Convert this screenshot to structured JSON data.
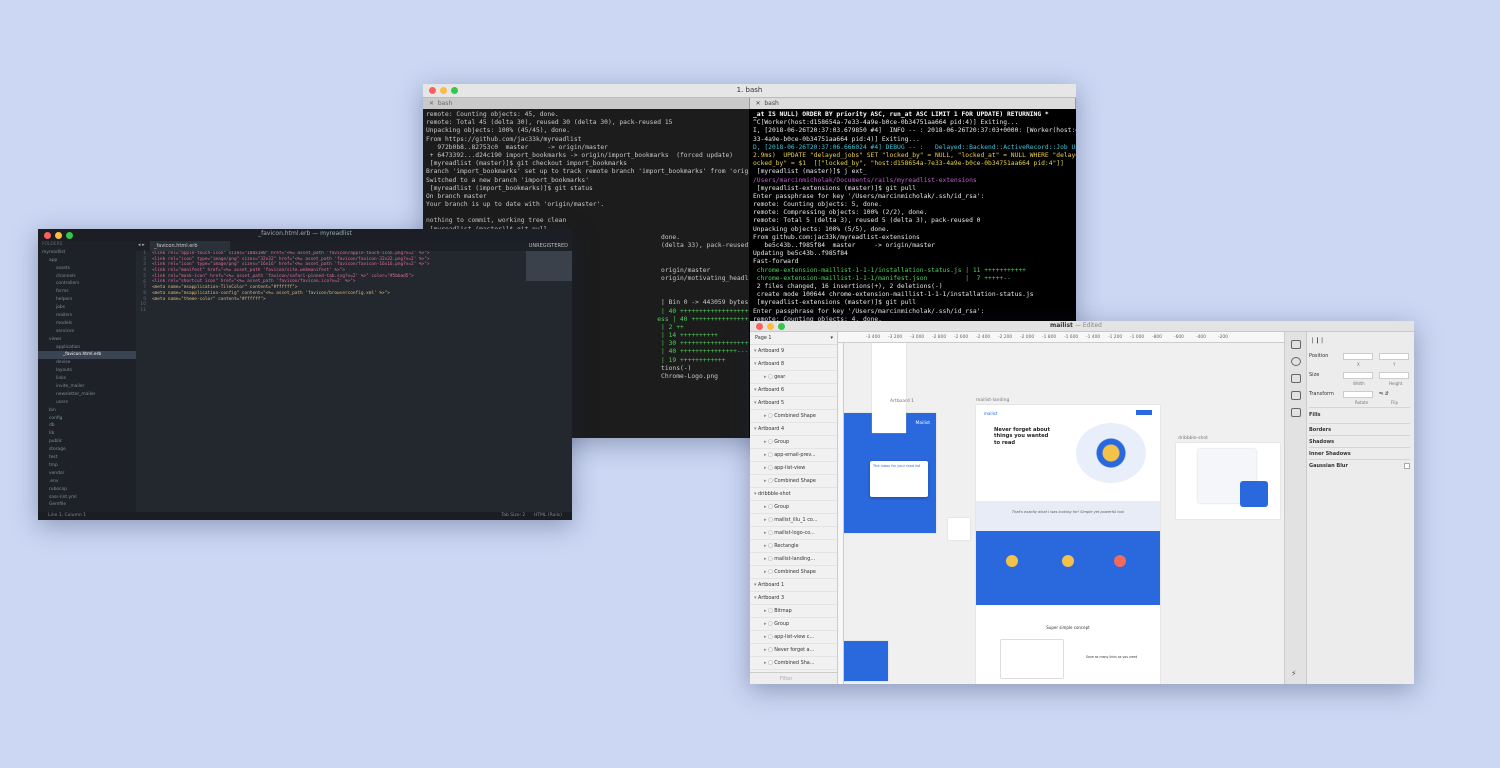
{
  "terminal": {
    "title": "1. bash",
    "left_tab": "bash",
    "right_tab": "bash",
    "left_lines": [
      "remote: Counting objects: 45, done.",
      "remote: Total 45 (delta 30), reused 30 (delta 30), pack-reused 15",
      "Unpacking objects: 100% (45/45), done.",
      "From https://github.com/jac33k/myreadlist",
      "   972b0b8..82753c0  master     -> origin/master",
      " + 6473392...d24c190 import_bookmarks -> origin/import_bookmarks  (forced update)",
      " [myreadlist (master)]$ git checkout import_bookmarks",
      "Branch 'import_bookmarks' set up to track remote branch 'import_bookmarks' from 'origin'.",
      "Switched to a new branch 'import_bookmarks'",
      " [myreadlist (import_bookmarks)]$ git status",
      "On branch master",
      "Your branch is up to date with 'origin/master'.",
      "",
      "nothing to commit, working tree clean",
      " [myreadlist (master)]$ git pull",
      "                                                              done.",
      "                                                              (delta 33), pack-reused 0",
      "",
      "",
      "                                                              origin/master",
      "                                                              origin/motivating_headline",
      "",
      "",
      "                                                              | Bin 0 -> 443059 bytes",
      "                                                              | 40 ++++++++++++++++++++++++++++++++++",
      "                                                             ess | 40 ++++++++++++++++++++++++++++++---",
      "                                                              | 2 ++",
      "                                                              | 14 ++++++++++",
      "                                                              | 30 +++++++++++++++++++-----",
      "                                                              | 40 +++++++++++++++---------",
      "                                                              | 19 ++++++++++++",
      "                                                              tions(-)",
      "                                                              Chrome-Logo.png"
    ],
    "right_lines": [
      "_at IS NULL) ORDER BY priority ASC, run_at ASC LIMIT 1 FOR UPDATE) RETURNING *",
      "^C[Worker(host:d158654a-7e33-4a9e-b0ce-0b34751aa664 pid:4)] Exiting...",
      "I, [2018-06-26T20:37:03.679850 #4]  INFO -- : 2018-06-26T20:37:03+0000: [Worker(host:d158654a-7e",
      "33-4a9e-b0ce-0b34751aa664 pid:4)] Exiting...",
      "D, [2018-06-26T20:37:06.666024 #4] DEBUG -- :   Delayed::Backend::ActiveRecord::Job Update All (",
      "2.9ms)  UPDATE \"delayed_jobs\" SET \"locked_by\" = NULL, \"locked_at\" = NULL WHERE \"delayed_jobs\".\"l",
      "ocked_by\" = $1  [[\"locked_by\", \"host:d158654a-7e33-4a9e-b0ce-0b34751aa664 pid:4\"]]",
      " [myreadlist (master)]$ j ext_",
      "/Users/marcinmicholak/Documents/rails/myreadlist-extensions",
      " [myreadlist-extensions (master)]$ git pull",
      "Enter passphrase for key '/Users/marcinmicholak/.ssh/id_rsa':",
      "remote: Counting objects: 5, done.",
      "remote: Compressing objects: 100% (2/2), done.",
      "remote: Total 5 (delta 3), reused 5 (delta 3), pack-reused 0",
      "Unpacking objects: 100% (5/5), done.",
      "From github.com:jac33k/myreadlist-extensions",
      "   be5c43b..f985f84  master     -> origin/master",
      "Updating be5c43b..f985f84",
      "Fast-forward",
      " chrome-extension-maillist-1-1-1/installation-status.js | 11 +++++++++++",
      " chrome-extension-maillist-1-1-1/manifest.json          |  7 +++++--",
      " 2 files changed, 16 insertions(+), 2 deletions(-)",
      " create mode 100644 chrome-extension-maillist-1-1-1/installation-status.js",
      " [myreadlist-extensions (master)]$ git pull",
      "Enter passphrase for key '/Users/marcinmicholak/.ssh/id_rsa':",
      "remote: Counting objects: 4, done."
    ]
  },
  "editor": {
    "title": "_favicon.html.erb — myreadlist",
    "tab": "_favicon.html.erb",
    "unregistered": "UNREGISTERED",
    "status_left": "Line 1, Column 1",
    "status_tab": "Tab Size: 2",
    "status_syntax": "HTML (Rails)",
    "folders_label": "FOLDERS",
    "tree": [
      "myreadlist",
      "app",
      "assets",
      "channels",
      "controllers",
      "forms",
      "helpers",
      "jobs",
      "mailers",
      "models",
      "services",
      "views",
      "application",
      "_favicon.html.erb",
      "devise",
      "layouts",
      "links",
      "invite_mailer",
      "newsletter_mailer",
      "users",
      "bin",
      "config",
      "db",
      "lib",
      "public",
      "storage",
      "test",
      "tmp",
      "vendor",
      ".env",
      "rubocop",
      "sass-lint.yml",
      "Gemfile"
    ],
    "code_lines": [
      "<link rel=\"apple-touch-icon\" sizes=\"180x180\" href=\"<%= asset_path 'favicon/apple-touch-icon.png?v=2' %>\">",
      "<link rel=\"icon\" type=\"image/png\" sizes=\"32x32\" href=\"<%= asset_path 'favicon/favicon-32x32.png?v=2' %>\">",
      "<link rel=\"icon\" type=\"image/png\" sizes=\"16x16\" href=\"<%= asset_path 'favicon/favicon-16x16.png?v=2' %>\">",
      "<link rel=\"manifest\" href=\"<%= asset_path 'favicon/site.webmanifest' %>\">",
      "<link rel=\"mask-icon\" href=\"<%= asset_path 'favicon/safari-pinned-tab.svg?v=2' %>\" color=\"#5bbad5\">",
      "<link rel=\"shortcut icon\" href=\"<%= asset_path 'favicon/favicon.ico?v=2' %>\">",
      "<meta name=\"msapplication-TileColor\" content=\"#ffffff\">",
      "<meta name=\"msapplication-config\" content=\"<%= asset_path 'favicon/browserconfig.xml' %>\">",
      "<meta name=\"theme-color\" content=\"#ffffff\">",
      "",
      ""
    ]
  },
  "sketch": {
    "title": "mailist",
    "title_suffix": "— Edited",
    "page": "Page 1",
    "layers": [
      {
        "label": "Artboard 9",
        "indent": 0
      },
      {
        "label": "Artboard 8",
        "indent": 0
      },
      {
        "label": "gear",
        "indent": 1
      },
      {
        "label": "Artboard 6",
        "indent": 0
      },
      {
        "label": "Artboard 5",
        "indent": 0
      },
      {
        "label": "Combined Shape",
        "indent": 1
      },
      {
        "label": "Artboard 4",
        "indent": 0
      },
      {
        "label": "Group",
        "indent": 1
      },
      {
        "label": "app-email-prev...",
        "indent": 1
      },
      {
        "label": "app-list-view",
        "indent": 1
      },
      {
        "label": "Combined Shape",
        "indent": 1
      },
      {
        "label": "dribbble-shot",
        "indent": 0
      },
      {
        "label": "Group",
        "indent": 1
      },
      {
        "label": "mailist_illu_1 co...",
        "indent": 1
      },
      {
        "label": "mailist-logo-co...",
        "indent": 1
      },
      {
        "label": "Rectangle",
        "indent": 1
      },
      {
        "label": "mailist-landing...",
        "indent": 1
      },
      {
        "label": "Combined Shape",
        "indent": 1
      },
      {
        "label": "Artboard 1",
        "indent": 0
      },
      {
        "label": "Artboard 3",
        "indent": 0
      },
      {
        "label": "Bitmap",
        "indent": 1
      },
      {
        "label": "Group",
        "indent": 1
      },
      {
        "label": "app-list-view c...",
        "indent": 1
      },
      {
        "label": "Never forget a...",
        "indent": 1
      },
      {
        "label": "Combined Sha...",
        "indent": 1
      }
    ],
    "filter_placeholder": "Filter",
    "ruler": [
      "-3 400",
      "-3 200",
      "-3 000",
      "-2 800",
      "-2 600",
      "-2 400",
      "-2 200",
      "-2 000",
      "-1 800",
      "-1 600",
      "-1 400",
      "-1 200",
      "-1 000",
      "-800",
      "-600",
      "-400",
      "-200"
    ],
    "inspector": {
      "position": "Position",
      "x": "X",
      "y": "Y",
      "size": "Size",
      "width": "Width",
      "height": "Height",
      "transform": "Transform",
      "rotate": "Rotate",
      "flip": "Flip",
      "fills": "Fills",
      "borders": "Borders",
      "shadows": "Shadows",
      "inner_shadows": "Inner Shadows",
      "gaussian_blur": "Gaussian Blur"
    },
    "artboards": {
      "a1": "Artboard 1",
      "landing": "mailist-landing",
      "dribbble": "dribbble-shot"
    },
    "landing": {
      "logo": "mailist",
      "headline": "Never forget about things you wanted to read",
      "tagline": "That's exactly what I was looking for! Simple yet powerful tool",
      "concept": "Super simple concept",
      "footer_text": "Save as many links as you need"
    },
    "app_logo": "Mailist",
    "app_sub": "The inbox for your read list",
    "colors": {
      "accent": "#2a68dd"
    }
  }
}
